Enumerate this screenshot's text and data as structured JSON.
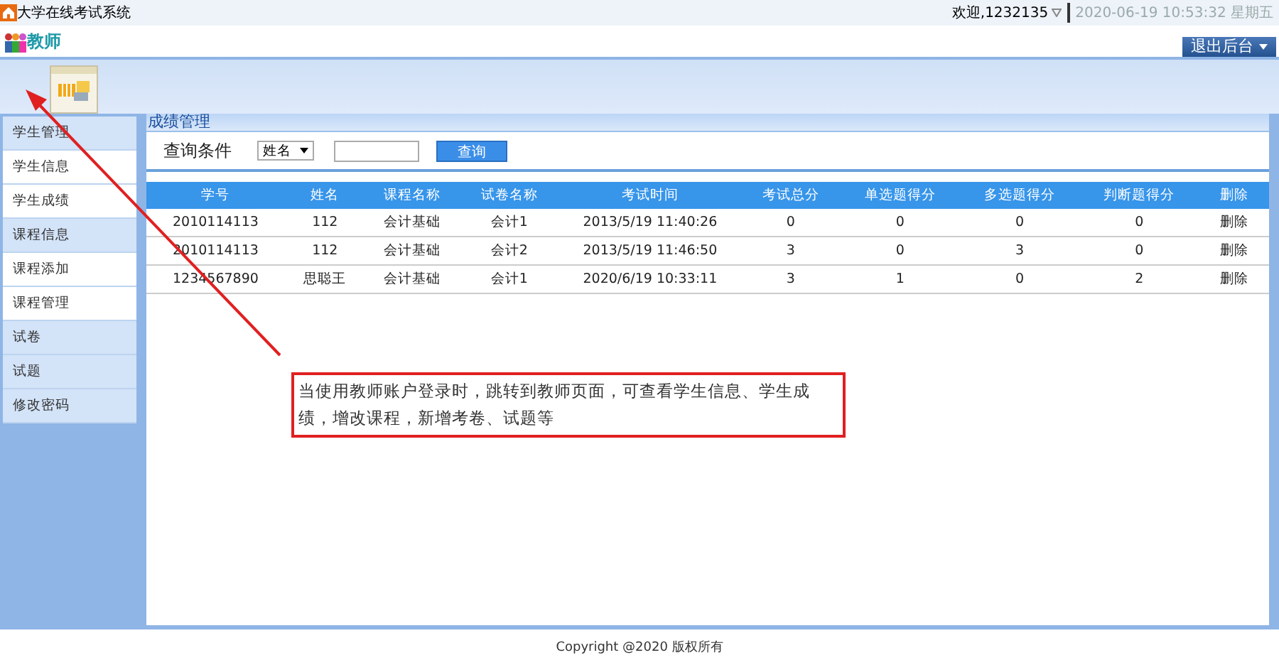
{
  "window": {
    "title": "大学在线考试系统"
  },
  "user_bar": {
    "welcome": "欢迎,1232135",
    "datetime": "2020-06-19 10:53:32 星期五"
  },
  "header": {
    "role": "教师",
    "logout_button": "退出后台"
  },
  "sidebar": {
    "items": [
      {
        "label": "学生管理",
        "children": [
          {
            "label": "学生信息"
          },
          {
            "label": "学生成绩"
          }
        ]
      },
      {
        "label": "课程信息",
        "children": [
          {
            "label": "课程添加"
          },
          {
            "label": "课程管理"
          }
        ]
      },
      {
        "label": "试卷"
      },
      {
        "label": "试题"
      },
      {
        "label": "修改密码"
      }
    ]
  },
  "panel": {
    "title": "成绩管理",
    "query": {
      "label": "查询条件",
      "field_select": "姓名",
      "button": "查询"
    },
    "table": {
      "columns": [
        "学号",
        "姓名",
        "课程名称",
        "试卷名称",
        "考试时间",
        "考试总分",
        "单选题得分",
        "多选题得分",
        "判断题得分",
        "删除"
      ],
      "rows": [
        [
          "2010114113",
          "112",
          "会计基础",
          "会计1",
          "2013/5/19 11:40:26",
          "0",
          "0",
          "0",
          "0",
          "删除"
        ],
        [
          "2010114113",
          "112",
          "会计基础",
          "会计2",
          "2013/5/19 11:46:50",
          "3",
          "0",
          "3",
          "0",
          "删除"
        ],
        [
          "1234567890",
          "思聪王",
          "会计基础",
          "会计1",
          "2020/6/19 10:33:11",
          "3",
          "1",
          "0",
          "2",
          "删除"
        ]
      ]
    }
  },
  "annotation": {
    "text": "当使用教师账户登录时，跳转到教师页面，可查看学生信息、学生成绩，增改课程，新增考卷、试题等"
  },
  "footer": {
    "copyright": "Copyright @2020 版权所有"
  }
}
